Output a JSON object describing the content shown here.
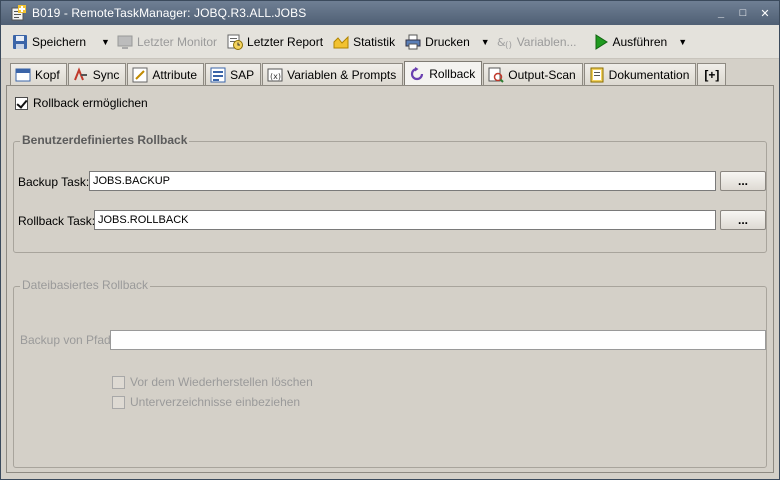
{
  "window": {
    "title": "B019 - RemoteTaskManager: JOBQ.R3.ALL.JOBS",
    "minimize": "_",
    "maximize": "□",
    "close": "✕"
  },
  "toolbar": {
    "save": "Speichern",
    "last_monitor": "Letzter Monitor",
    "last_report": "Letzter Report",
    "statistics": "Statistik",
    "print": "Drucken",
    "variables": "Variablen...",
    "execute": "Ausführen",
    "dropdown_arrow": "▼"
  },
  "tabs": [
    {
      "label": "Kopf",
      "icon": "header-icon"
    },
    {
      "label": "Sync",
      "icon": "sync-icon"
    },
    {
      "label": "Attribute",
      "icon": "attribute-icon"
    },
    {
      "label": "SAP",
      "icon": "sap-icon"
    },
    {
      "label": "Variablen & Prompts",
      "icon": "variables-icon"
    },
    {
      "label": "Rollback",
      "icon": "rollback-icon",
      "active": true
    },
    {
      "label": "Output-Scan",
      "icon": "output-scan-icon"
    },
    {
      "label": "Dokumentation",
      "icon": "documentation-icon"
    },
    {
      "label": "[+]",
      "icon": "add-tab-icon"
    }
  ],
  "rollback": {
    "enable_label": "Rollback ermöglichen",
    "enable_checked": true,
    "custom_group_title": "Benutzerdefiniertes Rollback",
    "backup_task_label": "Backup Task:",
    "backup_task_value": "JOBS.BACKUP",
    "rollback_task_label": "Rollback Task:",
    "rollback_task_value": "JOBS.ROLLBACK",
    "browse_label": "...",
    "file_group_title": "Dateibasiertes Rollback",
    "backup_path_label": "Backup von Pfad:",
    "backup_path_value": "",
    "delete_before_restore_label": "Vor dem Wiederherstellen löschen",
    "include_subdirs_label": "Unterverzeichnisse einbeziehen"
  },
  "colors": {
    "titlebar": "#5f6f84",
    "window_bg": "#d4d0c8",
    "execute_green": "#1f9a1f"
  }
}
